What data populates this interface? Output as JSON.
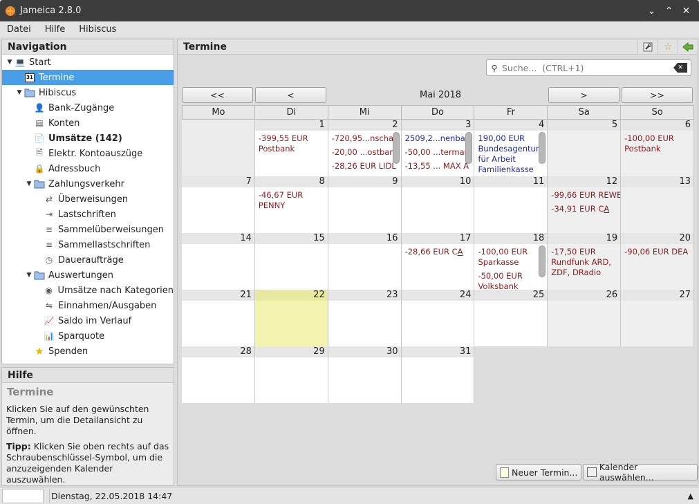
{
  "window": {
    "title": "Jameica 2.8.0"
  },
  "menu": [
    "Datei",
    "Hilfe",
    "Hibiscus"
  ],
  "navigation": {
    "title": "Navigation",
    "items": [
      {
        "label": "Start",
        "level": 0,
        "toggle": "open",
        "icon": "monitor-icon"
      },
      {
        "label": "Termine",
        "level": 1,
        "icon": "calendar-icon",
        "selected": true
      },
      {
        "label": "Hibiscus",
        "level": 1,
        "toggle": "open",
        "icon": "folder-icon"
      },
      {
        "label": "Bank-Zugänge",
        "level": 2,
        "icon": "user-icon"
      },
      {
        "label": "Konten",
        "level": 2,
        "icon": "ledger-icon"
      },
      {
        "label": "Umsätze (142)",
        "level": 2,
        "icon": "document-icon",
        "bold": true
      },
      {
        "label": "Elektr. Kontoauszüge",
        "level": 2,
        "icon": "pdf-icon"
      },
      {
        "label": "Adressbuch",
        "level": 2,
        "icon": "lock-icon"
      },
      {
        "label": "Zahlungsverkehr",
        "level": 2,
        "toggle": "open",
        "icon": "folder-icon"
      },
      {
        "label": "Überweisungen",
        "level": 3,
        "icon": "transfer-icon"
      },
      {
        "label": "Lastschriften",
        "level": 3,
        "icon": "debit-icon"
      },
      {
        "label": "Sammelüberweisungen",
        "level": 3,
        "icon": "batch-transfer-icon"
      },
      {
        "label": "Sammellastschriften",
        "level": 3,
        "icon": "batch-debit-icon"
      },
      {
        "label": "Daueraufträge",
        "level": 3,
        "icon": "clock-icon"
      },
      {
        "label": "Auswertungen",
        "level": 2,
        "toggle": "open",
        "icon": "folder-icon"
      },
      {
        "label": "Umsätze nach Kategorien",
        "level": 3,
        "icon": "category-icon"
      },
      {
        "label": "Einnahmen/Ausgaben",
        "level": 3,
        "icon": "arrows-icon"
      },
      {
        "label": "Saldo im Verlauf",
        "level": 3,
        "icon": "line-chart-icon"
      },
      {
        "label": "Sparquote",
        "level": 3,
        "icon": "chart-icon"
      },
      {
        "label": "Spenden",
        "level": 2,
        "icon": "star-icon"
      }
    ]
  },
  "help": {
    "title": "Hilfe",
    "subtitle": "Termine",
    "text1": "Klicken Sie auf den gewünschten Termin, um die Detailansicht zu öffnen.",
    "tip_label": "Tipp:",
    "tip_text": " Klicken Sie oben rechts auf das Schraubenschlüssel-Symbol, um die anzuzeigenden Kalender auszuwählen."
  },
  "main": {
    "title": "Termine",
    "search_placeholder": "Suche...  (CTRL+1)",
    "buttons": {
      "first": "<<",
      "prev": "<",
      "next": ">",
      "last": ">>"
    },
    "month": "Mai 2018",
    "weekdays": [
      "Mo",
      "Di",
      "Mi",
      "Do",
      "Fr",
      "Sa",
      "So"
    ],
    "new_button": "Neuer Termin...",
    "calendar_button": "Kalender auswählen..."
  },
  "status": {
    "text": "Dienstag, 22.05.2018 14:47"
  },
  "colors": {
    "selection": "#4a9ee8",
    "expense": "#8b1a1a",
    "income": "#1a2a9a",
    "today": "#f3f3b0"
  }
}
